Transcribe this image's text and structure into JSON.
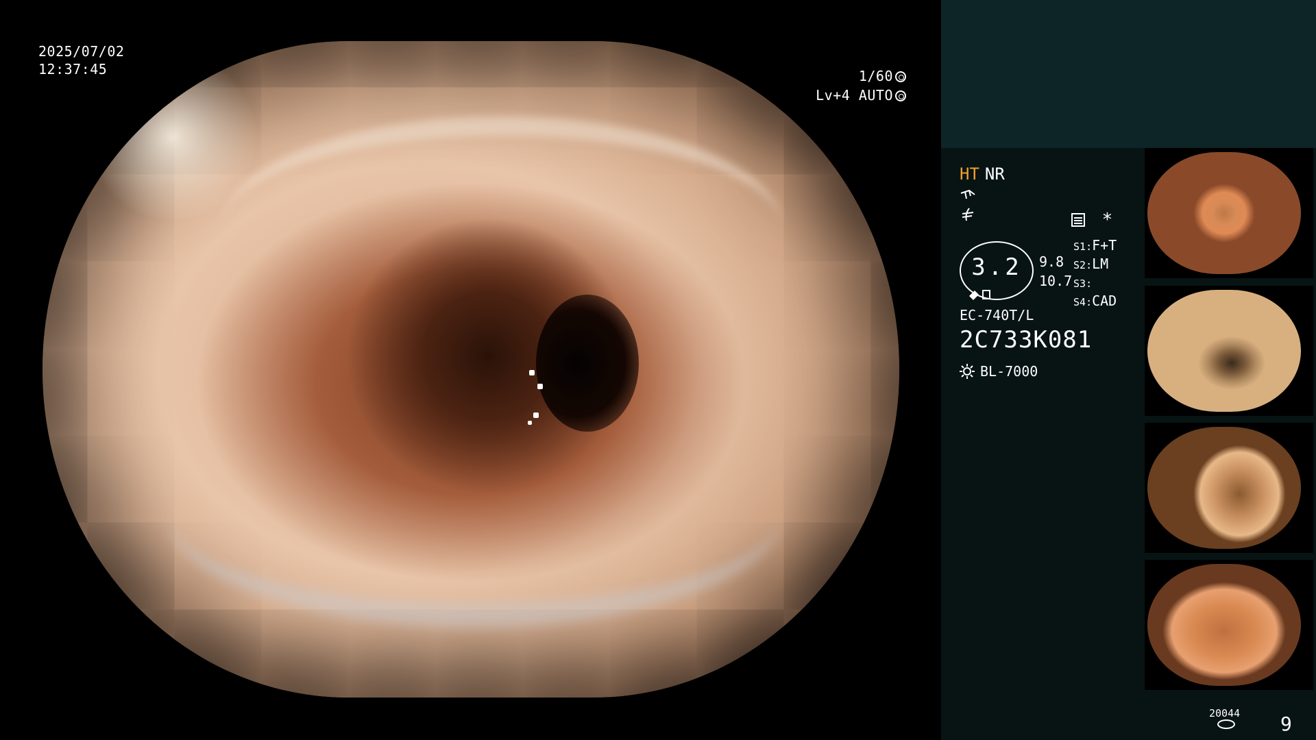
{
  "overlay": {
    "date": "2025/07/02",
    "time": "12:37:45",
    "shutter": "1/60",
    "level": "Lv+4",
    "mode": "AUTO"
  },
  "panel": {
    "ht_label": "HT",
    "nr_label": "NR",
    "asterisk": "*",
    "zoom_value": "3.2",
    "zoom_min": "9.8",
    "zoom_max": "10.7",
    "slots": [
      {
        "key": "S1",
        "value": "F+T"
      },
      {
        "key": "S2",
        "value": "LM"
      },
      {
        "key": "S3",
        "value": ""
      },
      {
        "key": "S4",
        "value": "CAD"
      }
    ],
    "scope_model": "EC-740T/L",
    "scope_serial": "2C733K081",
    "light_source": "BL-7000",
    "record_count": "20044",
    "image_count": "9"
  },
  "icons": {
    "shutter": "shutter-icon",
    "mode": "auto-iris-icon",
    "light": "light-source-icon",
    "storage": "storage-disk-icon"
  },
  "colors": {
    "ht": "#f0a030",
    "panel_top": "#0d2526",
    "panel": "#081414"
  }
}
